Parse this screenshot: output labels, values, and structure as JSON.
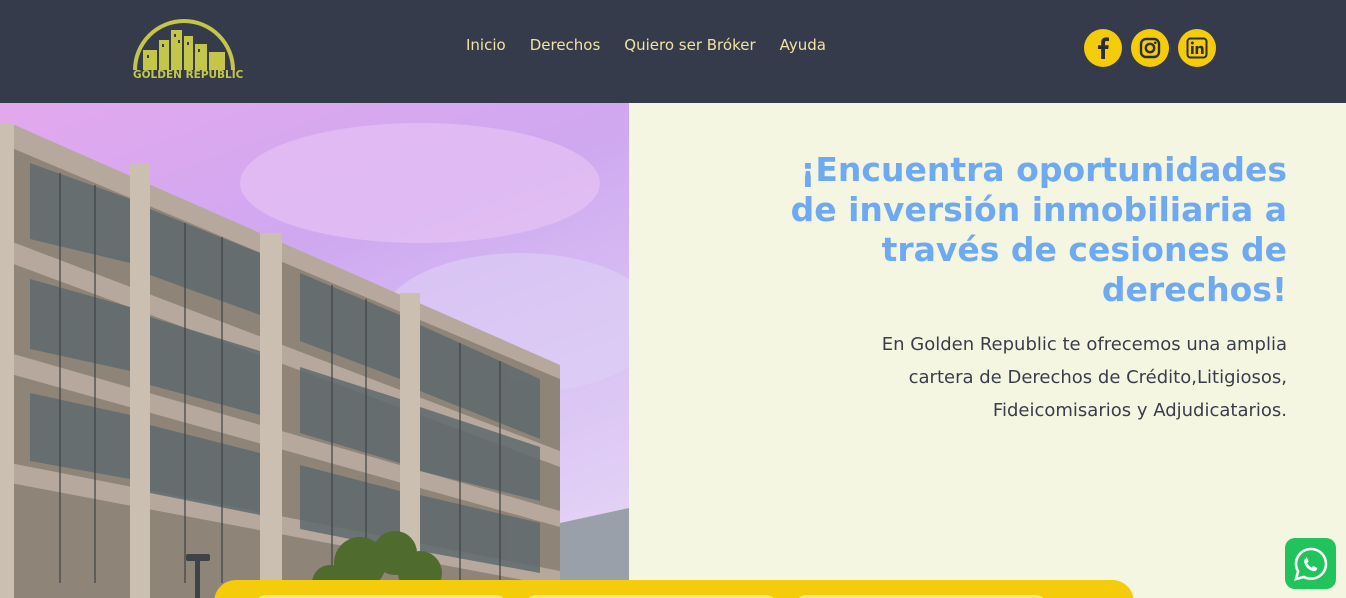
{
  "brand": {
    "name": "GOLDEN REPUBLIC",
    "logo_color": "#c4c64a"
  },
  "nav": {
    "items": [
      {
        "label": "Inicio"
      },
      {
        "label": "Derechos"
      },
      {
        "label": "Quiero ser Bróker"
      },
      {
        "label": "Ayuda"
      }
    ]
  },
  "social": [
    {
      "icon": "facebook-icon"
    },
    {
      "icon": "instagram-icon"
    },
    {
      "icon": "linkedin-icon"
    }
  ],
  "hero": {
    "headline_lines": [
      "¡Encuentra oportunidades",
      "de inversión inmobiliaria a",
      "través de cesiones de",
      "derechos!"
    ],
    "subtext_lines": [
      "En Golden Republic te ofrecemos una amplia",
      "cartera de Derechos de Crédito,Litigiosos,",
      "Fideicomisarios y Adjudicatarios."
    ]
  },
  "colors": {
    "header_bg": "#363b4c",
    "nav_text": "#f0e2a2",
    "accent_yellow": "#f5cc0a",
    "headline": "#6ea9f2",
    "body_text": "#3a3d4b",
    "page_bg": "#f4f6e1",
    "whatsapp": "#20c45a"
  },
  "whatsapp": {
    "icon": "whatsapp-icon"
  }
}
